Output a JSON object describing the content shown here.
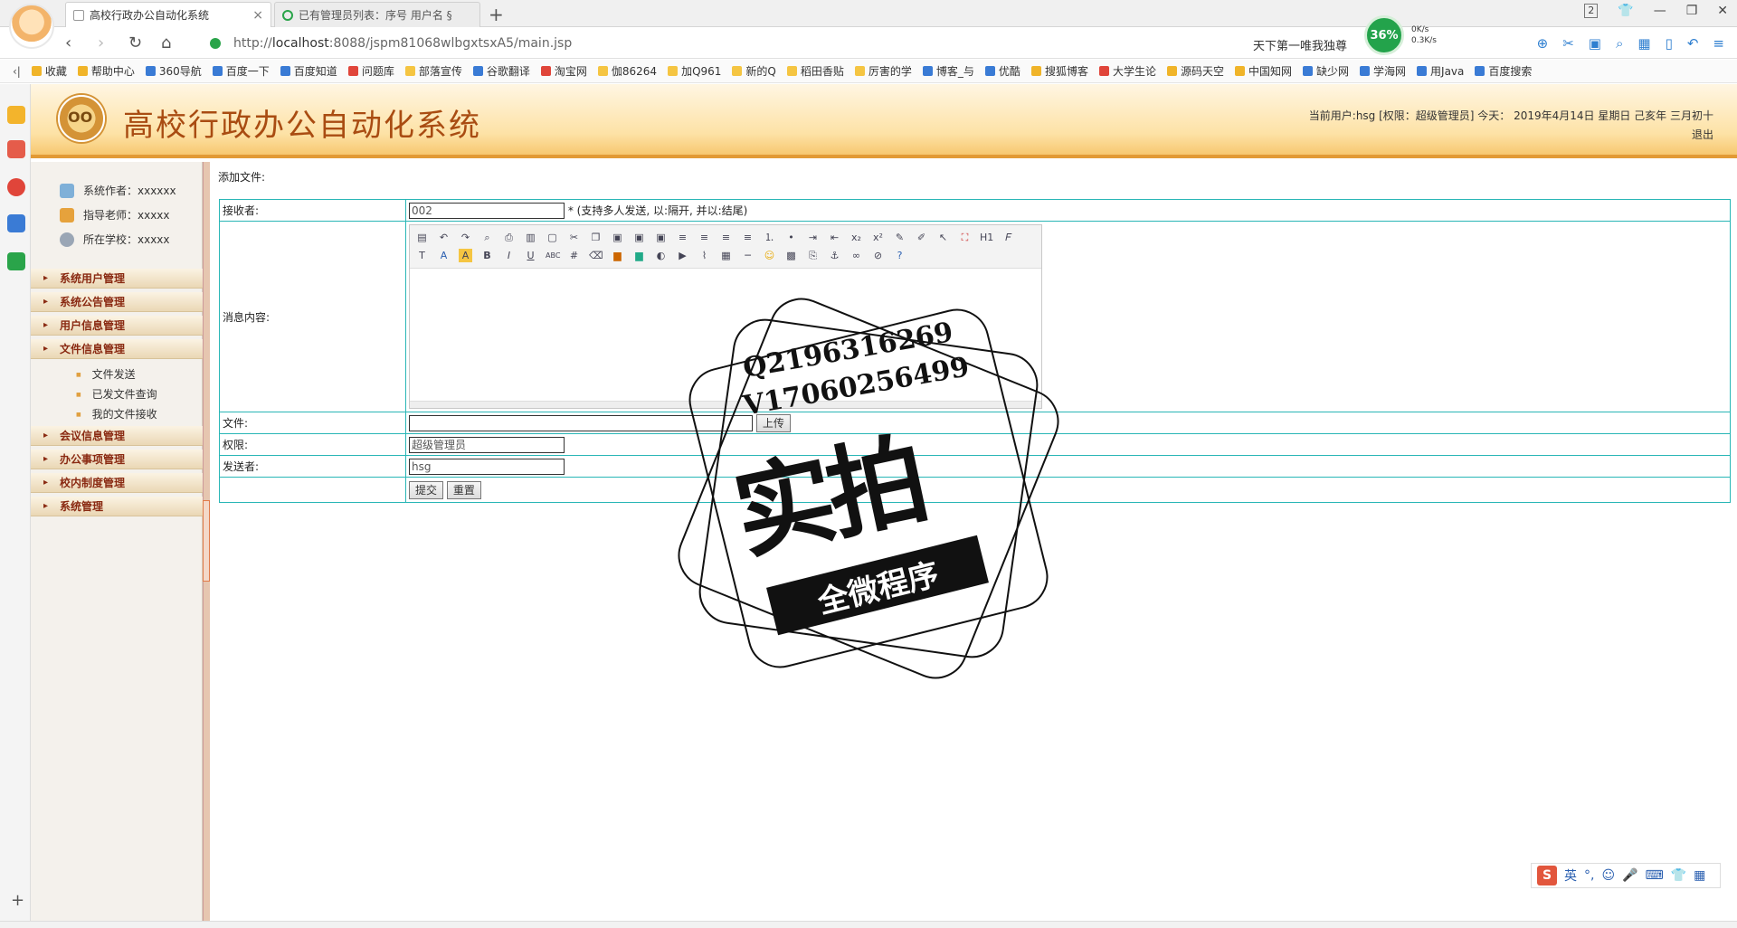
{
  "browser": {
    "tabs": [
      {
        "title": "高校行政办公自动化系统",
        "active": true
      },
      {
        "title": "已有管理员列表：序号 用户名 §",
        "active": false
      }
    ],
    "url_prefix": "http://",
    "url_host": "localhost",
    "url_rest": ":8088/jspm81068wlbgxtsxA5/main.jsp",
    "motto": "天下第一唯我独尊",
    "speed": {
      "percent": "36%",
      "up": "0K/s",
      "down": "0.3K/s"
    },
    "tab_count": "2",
    "bookmarks": [
      "收藏",
      "帮助中心",
      "360导航",
      "百度一下",
      "百度知道",
      "问题库",
      "部落宣传",
      "谷歌翻译",
      "淘宝网",
      "伽86264",
      "加Q961",
      "新的Q",
      "稻田香贴",
      "厉害的学",
      "博客_与",
      "优酷",
      "搜狐博客",
      "大学生论",
      "源码天空",
      "中国知网",
      "缺少网",
      "学海网",
      "用Java",
      "百度搜索"
    ]
  },
  "app": {
    "title": "高校行政办公自动化系统",
    "user_info": "当前用户:hsg [权限：超级管理员] 今天：  2019年4月14日 星期日 己亥年 三月初十",
    "logout": "退出"
  },
  "sidebar": {
    "info": [
      {
        "label": "系统作者：xxxxxx",
        "icon": "author-icon"
      },
      {
        "label": "指导老师：xxxxx",
        "icon": "teacher-icon"
      },
      {
        "label": "所在学校：xxxxx",
        "icon": "school-icon"
      }
    ],
    "menus": [
      "系统用户管理",
      "系统公告管理",
      "用户信息管理",
      "文件信息管理",
      "会议信息管理",
      "办公事项管理",
      "校内制度管理",
      "系统管理"
    ],
    "sub_items": [
      "文件发送",
      "已发文件查询",
      "我的文件接收"
    ]
  },
  "form": {
    "heading": "添加文件:",
    "receiver_label": "接收者:",
    "receiver_value": "002",
    "receiver_hint": "* (支持多人发送, 以:隔开, 并以:结尾)",
    "content_label": "消息内容:",
    "file_label": "文件:",
    "upload_label": "上传",
    "permission_label": "权限:",
    "permission_value": "超级管理员",
    "sender_label": "发送者:",
    "sender_value": "hsg",
    "submit_label": "提交",
    "reset_label": "重置"
  },
  "watermark": {
    "line1": "Q2196316269",
    "line2": "V17060256499",
    "big": "实拍",
    "ribbon": "全微程序"
  },
  "ime": {
    "mode": "英"
  }
}
